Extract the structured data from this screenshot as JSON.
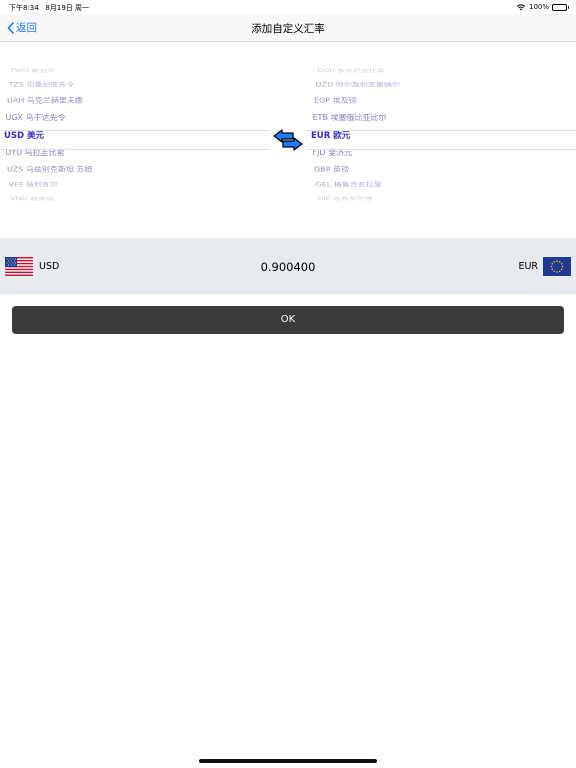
{
  "status": {
    "time": "下午8:34",
    "date": "8月19日 周一",
    "battery": "100%",
    "battery_level": 1.0
  },
  "nav": {
    "back_label": "返回",
    "title": "添加自定义汇率"
  },
  "left_picker": [
    "TWD 新台币",
    "TZS 坦桑尼亚先令",
    "UAH 乌克兰赫里夫娜",
    "UGX 乌干达先令",
    "USD 美元",
    "UYU 乌拉圭比索",
    "UZS 乌兹别克斯坦 苏姆",
    "VEF 玻利瓦尔",
    "VND 越南盾"
  ],
  "right_picker": [
    "DOP 多米尼加比索",
    "DZD 阿尔及利亚第纳尔",
    "EGP 埃及镑",
    "ETB 埃塞俄比亚比尔",
    "EUR 欧元",
    "FJD 斐济元",
    "GBP 英镑",
    "GEL 格鲁吉亚拉里",
    "GIP 直布罗陀镑"
  ],
  "result": {
    "from": "USD",
    "to": "EUR",
    "rate": "0.900400"
  },
  "ok_label": "OK",
  "colors": {
    "accent": "#1a7cf4",
    "picker_text": "#6a6ab8",
    "picker_selected": "#2d2dc8",
    "result_bg": "#e6ebef",
    "button_bg": "#3b3b3b"
  }
}
